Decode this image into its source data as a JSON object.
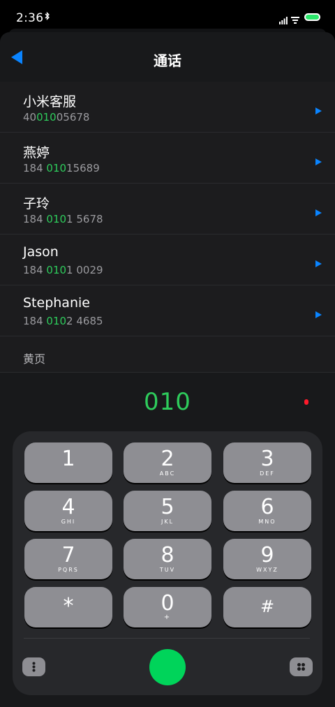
{
  "status_bar": {
    "time": "2:36",
    "bluetooth": "bluetooth-icon",
    "signal": "signal-icon",
    "wifi": "wifi-icon",
    "battery": "battery-icon"
  },
  "header": {
    "title": "通话"
  },
  "contacts": [
    {
      "name": "小米客服",
      "number_prefix": "40",
      "number_match": "010",
      "number_suffix": "05678"
    },
    {
      "name": "燕婷",
      "number_prefix": "184 ",
      "number_match": "010",
      "number_suffix": "15689"
    },
    {
      "name": "子玲",
      "number_prefix": "184 ",
      "number_match": "010",
      "number_suffix": "1 5678"
    },
    {
      "name": "Jason",
      "number_prefix": "184 ",
      "number_match": "010",
      "number_suffix": "1 0029"
    },
    {
      "name": "Stephanie",
      "number_prefix": "184 ",
      "number_match": "010",
      "number_suffix": "2 4685"
    }
  ],
  "yellow_pages": {
    "label": "黄页"
  },
  "dialer": {
    "entered_number": "010"
  },
  "keypad": {
    "keys": [
      {
        "digit": "1",
        "letters": ""
      },
      {
        "digit": "2",
        "letters": "ABC"
      },
      {
        "digit": "3",
        "letters": "DEF"
      },
      {
        "digit": "4",
        "letters": "GHI"
      },
      {
        "digit": "5",
        "letters": "JKL"
      },
      {
        "digit": "6",
        "letters": "MNO"
      },
      {
        "digit": "7",
        "letters": "PQRS"
      },
      {
        "digit": "8",
        "letters": "TUV"
      },
      {
        "digit": "9",
        "letters": "WXYZ"
      },
      {
        "digit": "*",
        "letters": ""
      },
      {
        "digit": "0",
        "letters": "+"
      },
      {
        "digit": "#",
        "letters": ""
      }
    ]
  },
  "colors": {
    "accent_blue": "#0a84ff",
    "match_green": "#2ecc5c",
    "call_green": "#00d45a",
    "key_gray": "#8e8e93",
    "record_red": "#ff1a2b"
  }
}
